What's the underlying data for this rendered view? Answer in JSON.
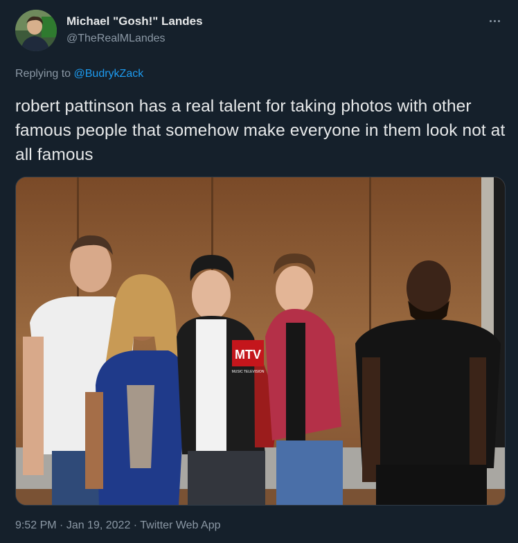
{
  "author": {
    "display_name": "Michael \"Gosh!\" Landes",
    "handle": "@TheRealMLandes"
  },
  "reply": {
    "prefix": "Replying to ",
    "mention": "@BudrykZack"
  },
  "tweet": {
    "text": "robert pattinson has a real talent for taking photos with other famous people that somehow make everyone in them look not at all famous"
  },
  "media": {
    "photo_logo_text": "MTV",
    "photo_logo_subtext": "MUSIC TELEVISION"
  },
  "meta": {
    "time": "9:52 PM",
    "sep1": " · ",
    "date": "Jan 19, 2022",
    "sep2": " · ",
    "source": "Twitter Web App"
  },
  "colors": {
    "background": "#15202b",
    "text": "#e7e9ea",
    "secondary": "#8b98a5",
    "link": "#1d9bf0"
  },
  "icons": [
    "more-options-icon",
    "avatar-image",
    "photo"
  ]
}
